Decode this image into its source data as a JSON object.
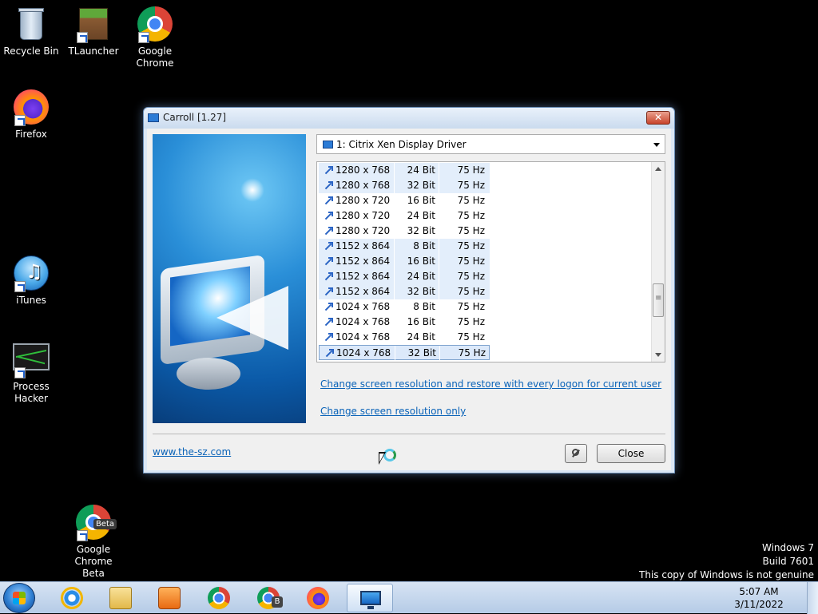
{
  "desktop": {
    "icons": [
      {
        "label": "Recycle Bin",
        "icon": "recycle-bin-icon"
      },
      {
        "label": "TLauncher",
        "icon": "tlauncher-icon"
      },
      {
        "label": "Google Chrome",
        "icon": "chrome-icon"
      },
      {
        "label": "Firefox",
        "icon": "firefox-icon"
      },
      {
        "label": "iTunes",
        "icon": "itunes-icon"
      },
      {
        "label": "Process Hacker",
        "icon": "process-hacker-icon"
      },
      {
        "label": "Google Chrome Beta",
        "icon": "chrome-beta-icon"
      }
    ],
    "watermark": {
      "line1": "Windows 7",
      "line2": "Build 7601",
      "line3": "This copy of Windows is not genuine"
    }
  },
  "window": {
    "title": "Carroll [1.27]",
    "close_glyph": "✕",
    "display_select": "1: Citrix Xen Display Driver",
    "modes": [
      {
        "res": "1280 x 768",
        "bit": "24 Bit",
        "hz": "75 Hz"
      },
      {
        "res": "1280 x 768",
        "bit": "32 Bit",
        "hz": "75 Hz"
      },
      {
        "res": "1280 x 720",
        "bit": "16 Bit",
        "hz": "75 Hz"
      },
      {
        "res": "1280 x 720",
        "bit": "24 Bit",
        "hz": "75 Hz"
      },
      {
        "res": "1280 x 720",
        "bit": "32 Bit",
        "hz": "75 Hz"
      },
      {
        "res": "1152 x 864",
        "bit": "8 Bit",
        "hz": "75 Hz"
      },
      {
        "res": "1152 x 864",
        "bit": "16 Bit",
        "hz": "75 Hz"
      },
      {
        "res": "1152 x 864",
        "bit": "24 Bit",
        "hz": "75 Hz"
      },
      {
        "res": "1152 x 864",
        "bit": "32 Bit",
        "hz": "75 Hz"
      },
      {
        "res": "1024 x 768",
        "bit": "8 Bit",
        "hz": "75 Hz"
      },
      {
        "res": "1024 x 768",
        "bit": "16 Bit",
        "hz": "75 Hz"
      },
      {
        "res": "1024 x 768",
        "bit": "24 Bit",
        "hz": "75 Hz"
      },
      {
        "res": "1024 x 768",
        "bit": "32 Bit",
        "hz": "75 Hz"
      }
    ],
    "link_restore": "Change screen resolution and restore with every logon for current user",
    "link_only": "Change screen resolution only",
    "website": "www.the-sz.com",
    "close_button": "Close"
  },
  "taskbar": {
    "items": [
      {
        "name": "internet-explorer",
        "icon": "ie-icon"
      },
      {
        "name": "windows-explorer",
        "icon": "folder-icon"
      },
      {
        "name": "media-player",
        "icon": "media-player-icon"
      },
      {
        "name": "google-chrome",
        "icon": "chrome-icon"
      },
      {
        "name": "google-chrome-beta",
        "icon": "chrome-beta-icon"
      },
      {
        "name": "firefox",
        "icon": "firefox-icon"
      },
      {
        "name": "carroll",
        "icon": "monitor-icon"
      }
    ],
    "time": "5:07 AM",
    "date": "3/11/2022",
    "beta_badge": "Beta",
    "beta_badge_small": "B"
  }
}
